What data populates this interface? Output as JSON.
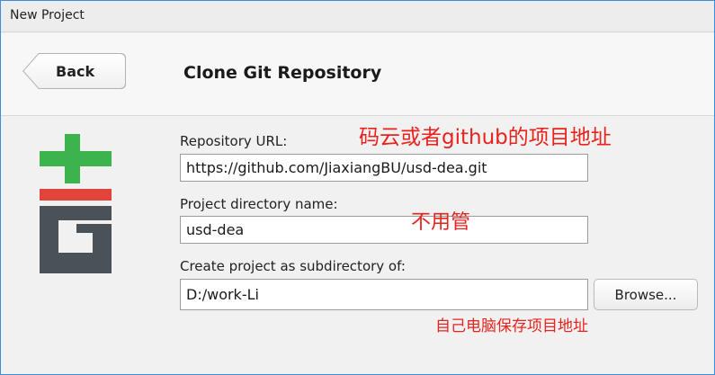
{
  "window": {
    "title": "New Project"
  },
  "header": {
    "back_label": "Back",
    "title": "Clone Git Repository"
  },
  "form": {
    "repo_url_label": "Repository URL:",
    "repo_url_value": "https://github.com/JiaxiangBU/usd-dea.git",
    "dir_name_label": "Project directory name:",
    "dir_name_value": "usd-dea",
    "subdir_label": "Create project as subdirectory of:",
    "subdir_value": "D:/work-Li",
    "browse_label": "Browse..."
  },
  "annotations": {
    "repo_note": "码云或者github的项目地址",
    "dir_note": "不用管",
    "subdir_note": "自己电脑保存项目地址"
  },
  "logo": {
    "icon": "git-logo-icon",
    "colors": {
      "plus": "#3cb44b",
      "bar": "#e2443a",
      "g": "#4a5157"
    }
  }
}
